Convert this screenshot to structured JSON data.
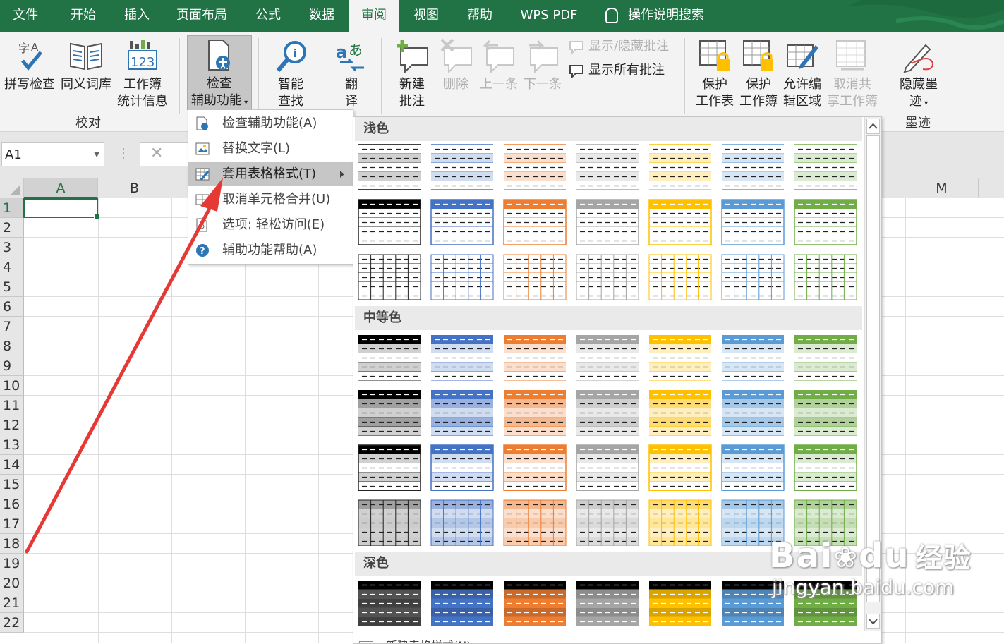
{
  "tabs": [
    {
      "label": "文件",
      "active": false
    },
    {
      "label": "开始",
      "active": false
    },
    {
      "label": "插入",
      "active": false
    },
    {
      "label": "页面布局",
      "active": false
    },
    {
      "label": "公式",
      "active": false
    },
    {
      "label": "数据",
      "active": false
    },
    {
      "label": "审阅",
      "active": true
    },
    {
      "label": "视图",
      "active": false
    },
    {
      "label": "帮助",
      "active": false
    },
    {
      "label": "WPS PDF",
      "active": false
    }
  ],
  "tell_me": "操作说明搜索",
  "ribbon": {
    "spelling": "拼写检查",
    "thesaurus": "同义词库",
    "workbook_stats_l1": "工作簿",
    "workbook_stats_l2": "统计信息",
    "check_access_l1": "检查",
    "check_access_l2": "辅助功能",
    "smart_lookup_l1": "智能",
    "smart_lookup_l2": "查找",
    "translate_l1": "翻",
    "translate_l2": "译",
    "new_comment_l1": "新建",
    "new_comment_l2": "批注",
    "delete": "删除",
    "previous": "上一条",
    "next": "下一条",
    "show_hide_comment": "显示/隐藏批注",
    "show_all_comments": "显示所有批注",
    "protect_sheet_l1": "保护",
    "protect_sheet_l2": "工作表",
    "protect_workbook_l1": "保护",
    "protect_workbook_l2": "工作簿",
    "allow_edit_l1": "允许编",
    "allow_edit_l2": "辑区域",
    "unshare_l1": "取消共",
    "unshare_l2": "享工作簿",
    "hide_ink_l1": "隐藏墨",
    "hide_ink_l2": "迹",
    "group_proofing": "校对",
    "group_ink": "墨迹"
  },
  "name_box": "A1",
  "columns": [
    "A",
    "B",
    "M"
  ],
  "rows": [
    "1",
    "2",
    "3",
    "4",
    "5",
    "6",
    "7",
    "8",
    "9",
    "10",
    "11",
    "12",
    "13",
    "14",
    "15",
    "16",
    "17",
    "18",
    "19",
    "20",
    "21",
    "22"
  ],
  "menu": [
    {
      "label": "检查辅助功能(A)",
      "hot": false,
      "submenu": false
    },
    {
      "label": "替换文字(L)",
      "hot": false,
      "submenu": false
    },
    {
      "label": "套用表格格式(T)",
      "hot": true,
      "submenu": true
    },
    {
      "label": "取消单元格合并(U)",
      "hot": false,
      "submenu": false
    },
    {
      "label": "选项: 轻松访问(E)",
      "hot": false,
      "submenu": false
    },
    {
      "label": "辅助功能帮助(A)",
      "hot": false,
      "submenu": false
    }
  ],
  "gallery": {
    "light": "浅色",
    "medium": "中等色",
    "dark": "深色",
    "new_style": "新建表格样式(N)...",
    "theme_colors": [
      "#000000",
      "#4472c4",
      "#ed7d31",
      "#a5a5a5",
      "#ffc000",
      "#5b9bd5",
      "#70ad47"
    ]
  },
  "watermark": {
    "brand": "Bai",
    "brand2": "du",
    "site": "经验",
    "url": "jingyan.baidu.com"
  }
}
